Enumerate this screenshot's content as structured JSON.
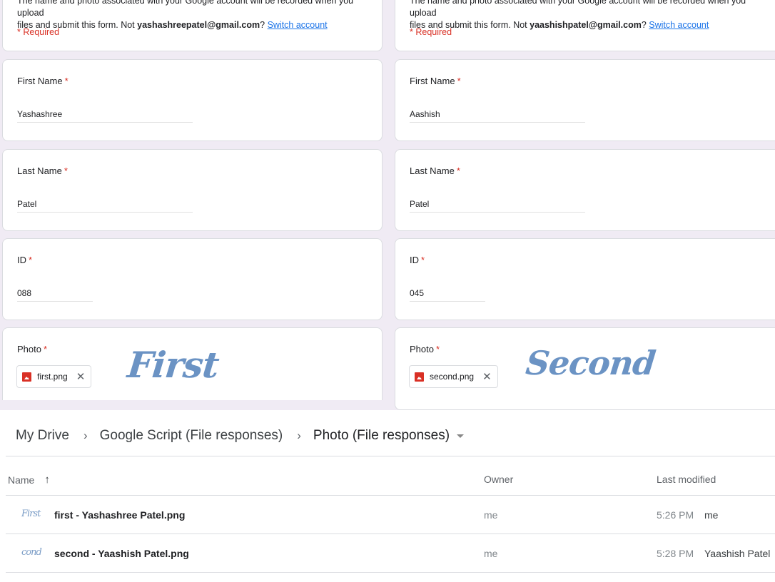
{
  "forms": [
    {
      "header": {
        "desc_line1": "The name and photo associated with your Google account will be recorded when you upload",
        "desc_line2_prefix": "files and submit this form. Not ",
        "email": "yashashreepatel@gmail.com",
        "desc_suffix": "?",
        "switch_account": "Switch account",
        "required_note": "* Required"
      },
      "questions": [
        {
          "title": "First Name",
          "star": "*",
          "value": "Yashashree"
        },
        {
          "title": "Last Name",
          "star": "*",
          "value": "Patel"
        },
        {
          "title": "ID",
          "star": "*",
          "value": "088"
        }
      ],
      "photo": {
        "title": "Photo",
        "star": "*",
        "file_icon": "image-file-icon",
        "file_name": "first.png",
        "remove_icon": "close-icon",
        "preview_text": "First"
      }
    },
    {
      "header": {
        "desc_line1": "The name and photo associated with your Google account will be recorded when you upload",
        "desc_line2_prefix": "files and submit this form. Not ",
        "email": "yaashishpatel@gmail.com",
        "desc_suffix": "?",
        "switch_account": "Switch account",
        "required_note": "* Required"
      },
      "questions": [
        {
          "title": "First Name",
          "star": "*",
          "value": "Aashish"
        },
        {
          "title": "Last Name",
          "star": "*",
          "value": "Patel"
        },
        {
          "title": "ID",
          "star": "*",
          "value": "045"
        }
      ],
      "photo": {
        "title": "Photo",
        "star": "*",
        "file_icon": "image-file-icon",
        "file_name": "second.png",
        "remove_icon": "close-icon",
        "preview_text": "Second"
      }
    }
  ],
  "drive": {
    "breadcrumb": [
      {
        "label": "My Drive"
      },
      {
        "label": "Google Script (File responses)"
      },
      {
        "label": "Photo (File responses)"
      }
    ],
    "separator": "›",
    "columns": {
      "name": "Name",
      "sort_arrow": "↑",
      "owner": "Owner",
      "last_modified": "Last modified"
    },
    "files": [
      {
        "thumb_text": "First",
        "name": "first - Yashashree Patel.png",
        "owner": "me",
        "modified_time": "5:26 PM",
        "modified_by": "me"
      },
      {
        "thumb_text": "cond",
        "name": "second - Yaashish Patel.png",
        "owner": "me",
        "modified_time": "5:28 PM",
        "modified_by": "Yaashish Patel"
      }
    ]
  },
  "colors": {
    "required_red": "#d93025",
    "link_blue": "#1a73e8",
    "form_background": "#f0ebf4",
    "script_blue": "#6b93c4"
  }
}
